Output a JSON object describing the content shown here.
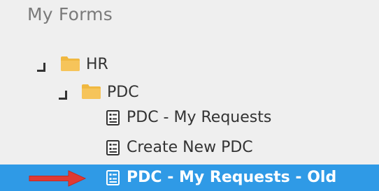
{
  "title": "My Forms",
  "tree": {
    "hr": {
      "label": "HR",
      "icon": "folder-icon"
    },
    "pdc": {
      "label": "PDC",
      "icon": "folder-icon"
    },
    "forms": [
      {
        "label": "PDC - My Requests",
        "icon": "form-document-icon"
      },
      {
        "label": "Create New PDC",
        "icon": "form-document-icon"
      },
      {
        "label": "PDC - My Requests - Old",
        "icon": "form-document-icon",
        "selected": true
      }
    ]
  },
  "colors": {
    "background": "#efefef",
    "selection": "#2f9ae6",
    "folder": "#f0b840",
    "pointer_arrow": "#e03a33"
  }
}
